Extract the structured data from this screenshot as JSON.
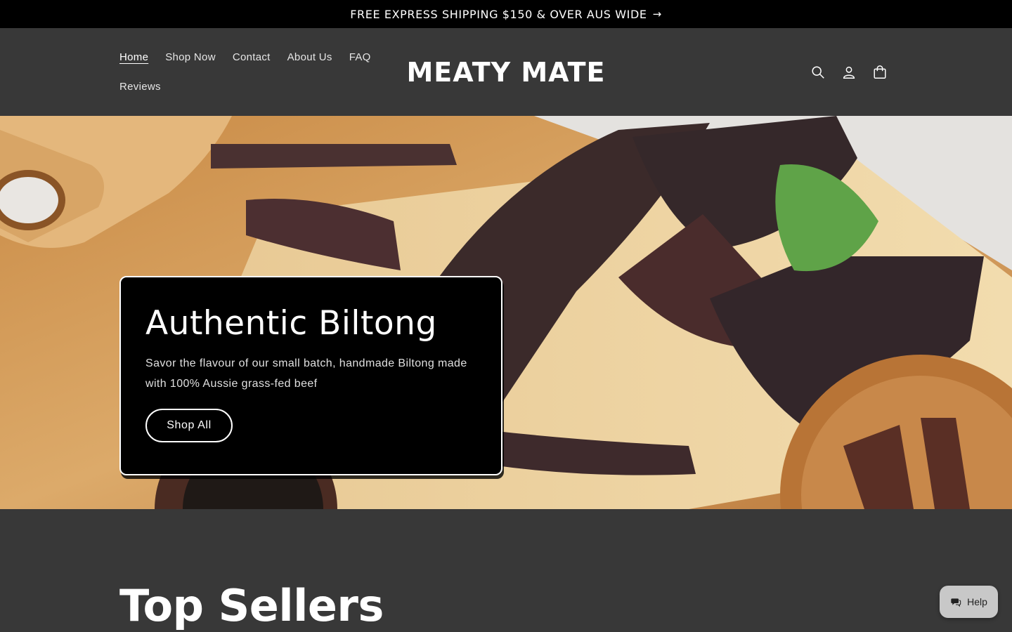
{
  "announcement": {
    "text": "FREE EXPRESS SHIPPING $150 & OVER AUS WIDE",
    "arrow": "→"
  },
  "nav": {
    "items": [
      {
        "label": "Home"
      },
      {
        "label": "Shop Now"
      },
      {
        "label": "Contact"
      },
      {
        "label": "About Us"
      },
      {
        "label": "FAQ"
      },
      {
        "label": "Reviews"
      }
    ]
  },
  "logo": {
    "text": "MEATY MATE"
  },
  "header_icons": [
    "search-icon",
    "account-icon",
    "cart-icon"
  ],
  "hero": {
    "title": "Authentic Biltong",
    "subtitle": "Savor the flavour of our small batch, handmade Biltong made with 100% Aussie grass-fed beef",
    "button": "Shop All"
  },
  "section": {
    "title": "Top Sellers"
  },
  "help": {
    "label": "Help",
    "icon": "chat-icon"
  },
  "colors": {
    "page_bg": "#383838",
    "announcement_bg": "#000000",
    "card_bg": "#000000",
    "text": "#ffffff"
  }
}
